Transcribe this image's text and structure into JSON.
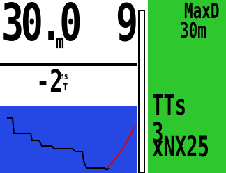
{
  "dive": {
    "depth": "30.0",
    "depth_unit": "m",
    "ndl": "9",
    "stop_depth": "-2",
    "stop_unit": "ns",
    "stop_unit_sub": "T"
  },
  "side_panel": {
    "maxd_label": "MaxD",
    "maxd_value": "30m",
    "tts_text": "TTs 3",
    "gas_text": "xNX25"
  },
  "colors": {
    "profile_bg": "#2547e4",
    "panel_bg": "#2ec82e",
    "profile_line": "#000000",
    "profile_ascent": "#e00000"
  }
}
